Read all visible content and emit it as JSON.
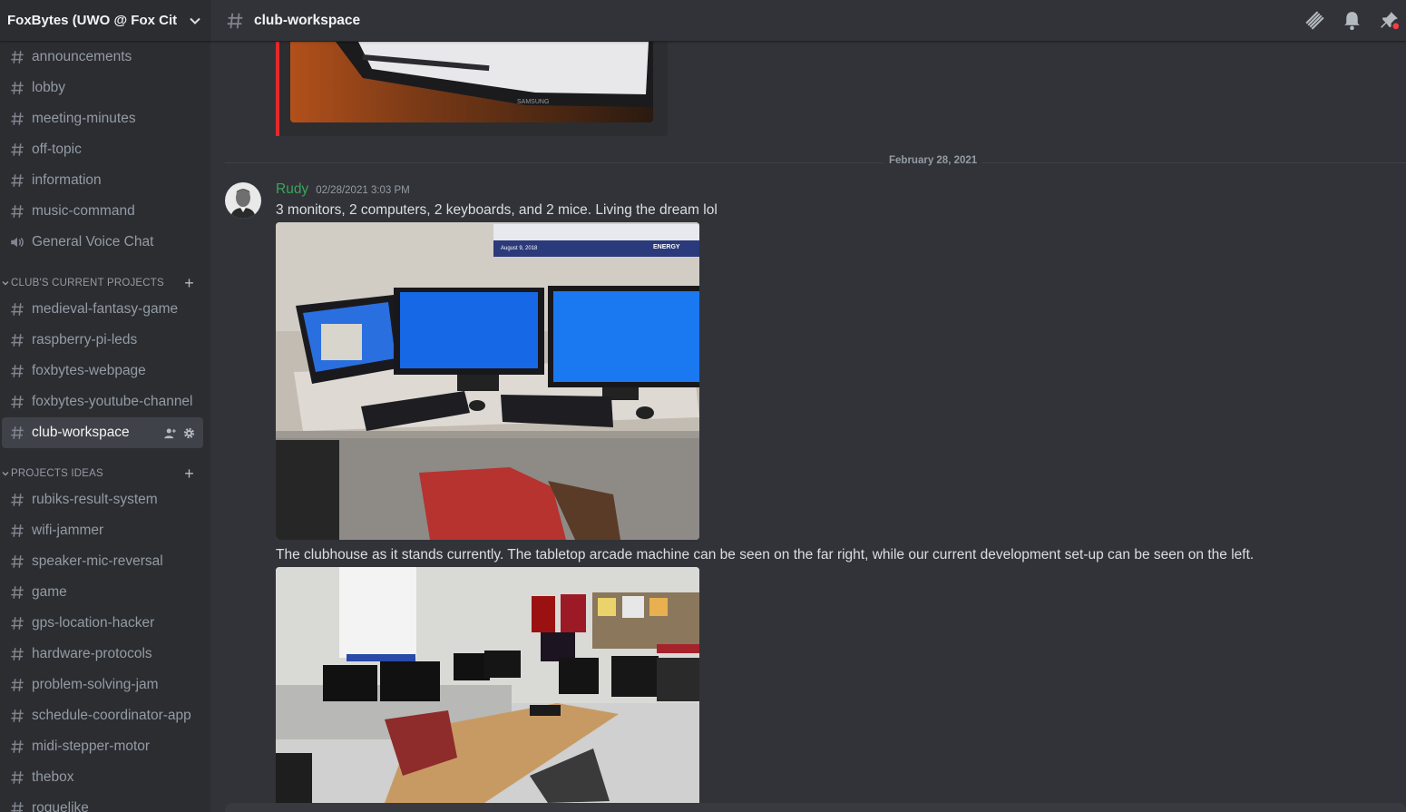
{
  "server": {
    "name": "FoxBytes (UWO @ Fox Cities)"
  },
  "channels_top": [
    {
      "name": "announcements",
      "type": "text"
    },
    {
      "name": "lobby",
      "type": "text"
    },
    {
      "name": "meeting-minutes",
      "type": "text"
    },
    {
      "name": "off-topic",
      "type": "text"
    },
    {
      "name": "information",
      "type": "text"
    },
    {
      "name": "music-command",
      "type": "text"
    },
    {
      "name": "General Voice Chat",
      "type": "voice"
    }
  ],
  "categories": [
    {
      "name": "CLUB'S CURRENT PROJECTS",
      "channels": [
        "medieval-fantasy-game",
        "raspberry-pi-leds",
        "foxbytes-webpage",
        "foxbytes-youtube-channel",
        "club-workspace"
      ],
      "active_index": 4
    },
    {
      "name": "PROJECTS IDEAS",
      "channels": [
        "rubiks-result-system",
        "wifi-jammer",
        "speaker-mic-reversal",
        "game",
        "gps-location-hacker",
        "hardware-protocols",
        "problem-solving-jam",
        "schedule-coordinator-app",
        "midi-stepper-motor",
        "thebox",
        "roguelike"
      ]
    }
  ],
  "topbar": {
    "channel": "club-workspace"
  },
  "icons": {
    "channel": "hash-icon",
    "voice": "speaker-icon",
    "topbar": [
      "threads-icon",
      "bell-icon",
      "pin-icon"
    ],
    "active_channel": [
      "add-member-icon",
      "gear-icon"
    ]
  },
  "messages": {
    "date_divider": "February 28, 2021",
    "author": "Rudy",
    "timestamp": "02/28/2021 3:03 PM",
    "text1": "3 monitors, 2 computers, 2 keyboards, and 2 mice. Living the dream lol",
    "text2": "The clubhouse as it stands currently. The tabletop arcade machine can be seen on the far right, while our current development set-up can be seen on the left.",
    "monitor_brand": "SAMSUNG",
    "poster_date": "August 9, 2018",
    "poster_logo": "ENERGY"
  },
  "colors": {
    "accent_author": "#3ba55d",
    "embed_border": "#e4292b",
    "background": "#313338",
    "sidebar": "#2b2d31",
    "active_channel": "#404249"
  }
}
